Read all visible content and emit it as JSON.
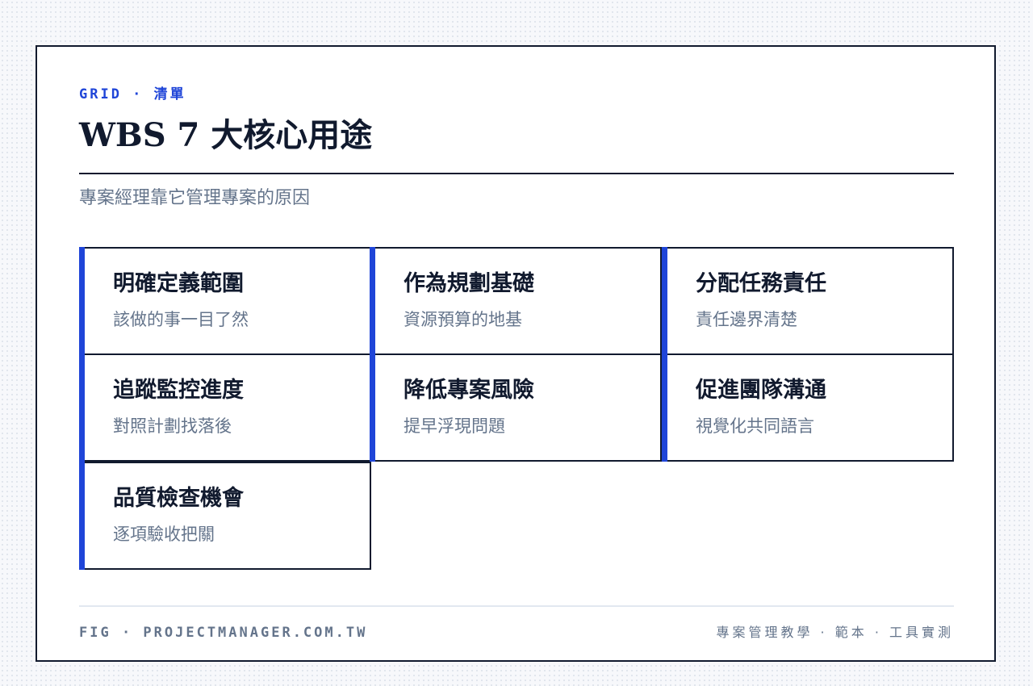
{
  "header": {
    "eyebrow": "GRID · 清單",
    "title": "WBS 7 大核心用途",
    "subtitle": "專案經理靠它管理專案的原因"
  },
  "items": [
    {
      "title": "明確定義範圍",
      "desc": "該做的事一目了然"
    },
    {
      "title": "作為規劃基礎",
      "desc": "資源預算的地基"
    },
    {
      "title": "分配任務責任",
      "desc": "責任邊界清楚"
    },
    {
      "title": "追蹤監控進度",
      "desc": "對照計劃找落後"
    },
    {
      "title": "降低專案風險",
      "desc": "提早浮現問題"
    },
    {
      "title": "促進團隊溝通",
      "desc": "視覺化共同語言"
    },
    {
      "title": "品質檢查機會",
      "desc": "逐項驗收把關"
    }
  ],
  "footer": {
    "left": "FIG · PROJECTMANAGER.COM.TW",
    "right": "專案管理教學 · 範本 · 工具實測"
  },
  "colors": {
    "accent": "#1f45d8",
    "ink": "#111a2e",
    "muted": "#64748b"
  }
}
